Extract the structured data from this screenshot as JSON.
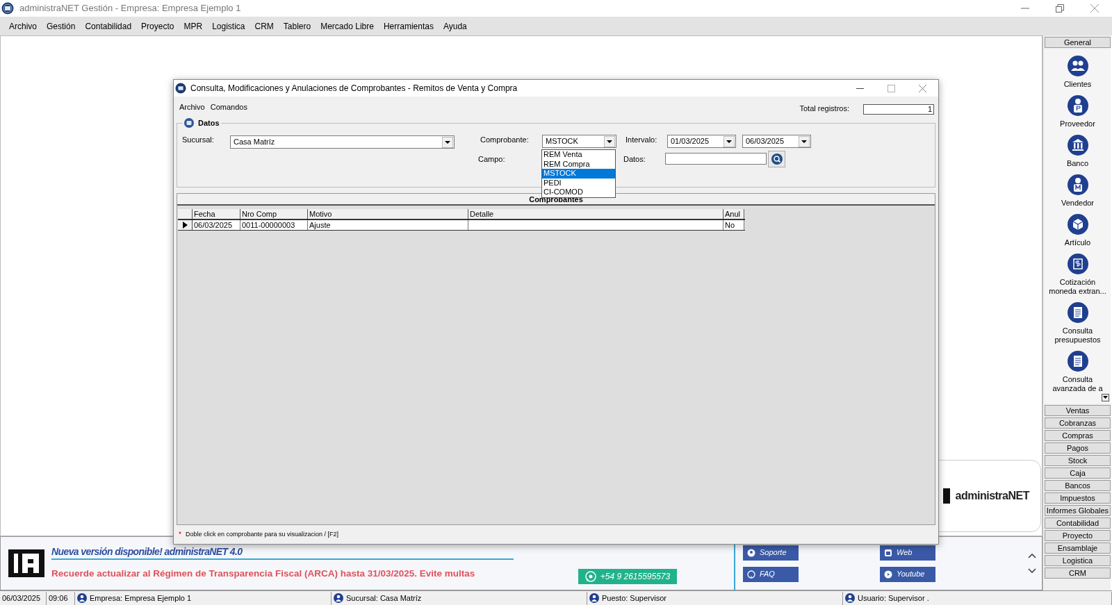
{
  "window": {
    "title": "administraNET Gestión - Empresa: Empresa Ejemplo 1"
  },
  "menu": [
    "Archivo",
    "Gestión",
    "Contabilidad",
    "Proyecto",
    "MPR",
    "Logistica",
    "CRM",
    "Tablero",
    "Mercado Libre",
    "Herramientas",
    "Ayuda"
  ],
  "dialog": {
    "title": "Consulta, Modificaciones y Anulaciones de Comprobantes - Remitos de Venta y Compra",
    "menu": [
      "Archivo",
      "Comandos"
    ],
    "total_label": "Total registros:",
    "total_value": "1",
    "group_title": "Datos",
    "sucursal": {
      "label": "Sucursal:",
      "value": "Casa Matríz"
    },
    "comprobante": {
      "label": "Comprobante:",
      "value": "MSTOCK",
      "options": [
        {
          "label": "REM Venta",
          "selected": false
        },
        {
          "label": "REM Compra",
          "selected": false
        },
        {
          "label": "MSTOCK",
          "selected": true
        },
        {
          "label": "PEDI",
          "selected": false
        },
        {
          "label": "CI-COMOD",
          "selected": false
        }
      ]
    },
    "intervalo": {
      "label": "Intervalo:",
      "from": "01/03/2025",
      "to": "06/03/2025"
    },
    "campo": {
      "label": "Campo:"
    },
    "datos": {
      "label": "Datos:"
    },
    "table": {
      "title": "Comprobantes",
      "columns": [
        "Fecha",
        "Nro Comp",
        "Motivo",
        "Detalle",
        "Anul"
      ],
      "rows": [
        {
          "cells": [
            "06/03/2025",
            "0011-00000003",
            "Ajuste",
            "",
            "No"
          ],
          "selected": true
        }
      ]
    },
    "footer": {
      "mark": "*",
      "text": "Doble click en comprobante para su visualizacion / [F2]"
    }
  },
  "logo_card": {
    "text": "administraNET"
  },
  "banner": {
    "headline": "Nueva versión disponible! administraNET 4.0",
    "notice": "Recuerde actualizar al Régimen de Transparencia Fiscal (ARCA) hasta 31/03/2025. Evite multas",
    "whatsapp": "+54 9 2615595573",
    "links": [
      "Soporte",
      "Web",
      "FAQ",
      "Youtube"
    ]
  },
  "sidebar": [
    {
      "label": "General",
      "items": [
        "Clientes",
        "Proveedor",
        "Banco",
        "Vendedor",
        "Artículo",
        "Cotización moneda extran...",
        "Consulta presupuestos",
        "Consulta avanzada de a"
      ]
    },
    {
      "label": "Ventas"
    },
    {
      "label": "Cobranzas"
    },
    {
      "label": "Compras"
    },
    {
      "label": "Pagos"
    },
    {
      "label": "Stock"
    },
    {
      "label": "Caja"
    },
    {
      "label": "Bancos"
    },
    {
      "label": "Impuestos"
    },
    {
      "label": "Informes Globales"
    },
    {
      "label": "Contabilidad"
    },
    {
      "label": "Proyecto"
    },
    {
      "label": "Ensamblaje"
    },
    {
      "label": "Logistica"
    },
    {
      "label": "CRM"
    }
  ],
  "status_bar": [
    {
      "kind": "plain",
      "text": "06/03/2025"
    },
    {
      "kind": "plain",
      "text": "09:06"
    },
    {
      "kind": "icon",
      "text": "Empresa: Empresa Ejemplo 1"
    },
    {
      "kind": "icon",
      "text": "Sucursal: Casa Matríz"
    },
    {
      "kind": "icon",
      "text": "Puesto: Supervisor"
    },
    {
      "kind": "icon",
      "text": "Usuario: Supervisor ."
    }
  ]
}
